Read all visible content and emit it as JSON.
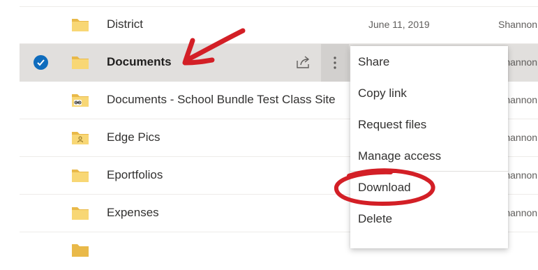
{
  "files": [
    {
      "name": "District",
      "date": "June 11, 2019",
      "owner": "Shannon",
      "selected": false,
      "folder_type": "plain"
    },
    {
      "name": "Documents",
      "date": "",
      "owner": "Shannon",
      "selected": true,
      "folder_type": "plain"
    },
    {
      "name": "Documents - School Bundle Test Class Site",
      "date": "",
      "owner": "Shannon",
      "selected": false,
      "folder_type": "shared-link"
    },
    {
      "name": "Edge Pics",
      "date": "",
      "owner": "Shannon",
      "selected": false,
      "folder_type": "shared-people"
    },
    {
      "name": "Eportfolios",
      "date": "",
      "owner": "Shannon",
      "selected": false,
      "folder_type": "plain"
    },
    {
      "name": "Expenses",
      "date": "",
      "owner": "Shannon",
      "selected": false,
      "folder_type": "plain"
    }
  ],
  "context_menu": {
    "items": [
      "Share",
      "Copy link",
      "Request files",
      "Manage access",
      "Download",
      "Delete"
    ]
  },
  "colors": {
    "folder": "#f8d775",
    "folder_dark": "#e9b949",
    "selection_check": "#0f6cbd",
    "annotation": "#d31f26"
  }
}
